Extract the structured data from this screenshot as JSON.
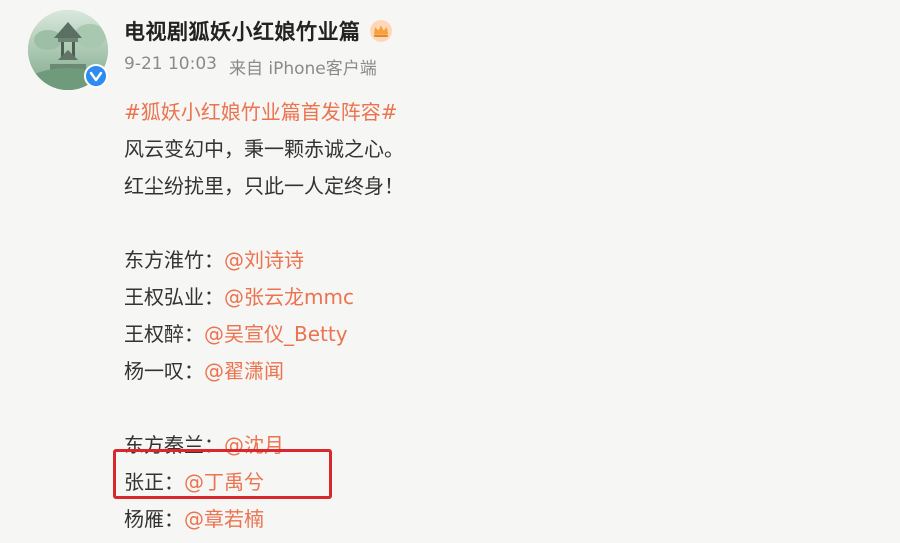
{
  "account": {
    "name": "电视剧狐妖小红娘竹业篇",
    "time": "9-21 10:03",
    "source": "来自 iPhone客户端"
  },
  "post": {
    "hashtag": "#狐妖小红娘竹业篇首发阵容#",
    "lines": [
      "风云变幻中，秉一颗赤诚之心。",
      "红尘纷扰里，只此一人定终身！"
    ],
    "cast_group_1": [
      {
        "role": "东方淮竹：",
        "actor": "@刘诗诗"
      },
      {
        "role": "王权弘业：",
        "actor": "@张云龙mmc"
      },
      {
        "role": "王权醉：",
        "actor": "@吴宣仪_Betty"
      },
      {
        "role": "杨一叹：",
        "actor": "@翟潇闻"
      }
    ],
    "cast_group_2": [
      {
        "role": "东方秦兰：",
        "actor": "@沈月"
      },
      {
        "role": "张正：",
        "actor": "@丁禹兮"
      },
      {
        "role": "杨雁：",
        "actor": "@章若楠"
      }
    ]
  },
  "colors": {
    "mention": "#eb7350",
    "highlight": "#d8272d",
    "verified": "#2e8bf0"
  },
  "icons": {
    "verified": "verified-badge-icon",
    "crown": "crown-icon"
  }
}
